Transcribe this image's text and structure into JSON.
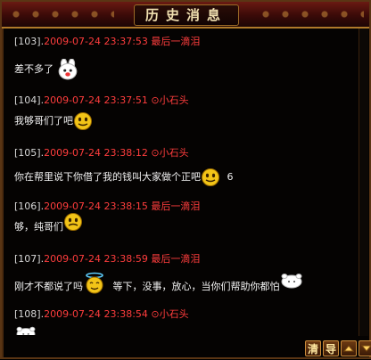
{
  "window": {
    "title": "历史消息"
  },
  "messages": [
    {
      "index": "[103].",
      "timestamp": "2009-07-24 23:37:53",
      "sender": "最后一滴泪",
      "sender_icon": "",
      "text": "差不多了",
      "suffix": "",
      "emoji": "white-bunny"
    },
    {
      "index": "[104].",
      "timestamp": "2009-07-24 23:37:51",
      "sender": "小石头",
      "sender_icon": "⊙",
      "text": "我够哥们了吧",
      "suffix": "",
      "emoji": "yellow-smiley"
    },
    {
      "index": "[105].",
      "timestamp": "2009-07-24 23:38:12",
      "sender": "小石头",
      "sender_icon": "⊙",
      "text": "你在帮里说下你借了我的钱叫大家做个正吧",
      "suffix": "6",
      "emoji": "yellow-smiley"
    },
    {
      "index": "[106].",
      "timestamp": "2009-07-24 23:38:15",
      "sender": "最后一滴泪",
      "sender_icon": "",
      "text": "够，纯哥们",
      "suffix": "",
      "emoji": "yellow-smiley"
    },
    {
      "index": "[107].",
      "timestamp": "2009-07-24 23:38:59",
      "sender": "最后一滴泪",
      "sender_icon": "",
      "text": "刚才不都说了吗",
      "text2": "等下，没事，放心，当你们帮助你都怕",
      "suffix": "",
      "emoji": "angel-smiley"
    },
    {
      "index": "[108].",
      "timestamp": "2009-07-24 23:38:54",
      "sender": "小石头",
      "sender_icon": "⊙",
      "text": "",
      "suffix": "",
      "emoji": "white-bunny"
    }
  ],
  "toolbar": {
    "clear_label": "清",
    "export_label": "导",
    "up_icon": "arrow-up-icon",
    "down_icon": "arrow-down-icon"
  },
  "colors": {
    "timestamp": "#ff3d3d",
    "title": "#f0e0b0",
    "frame": "#c98b3a"
  }
}
